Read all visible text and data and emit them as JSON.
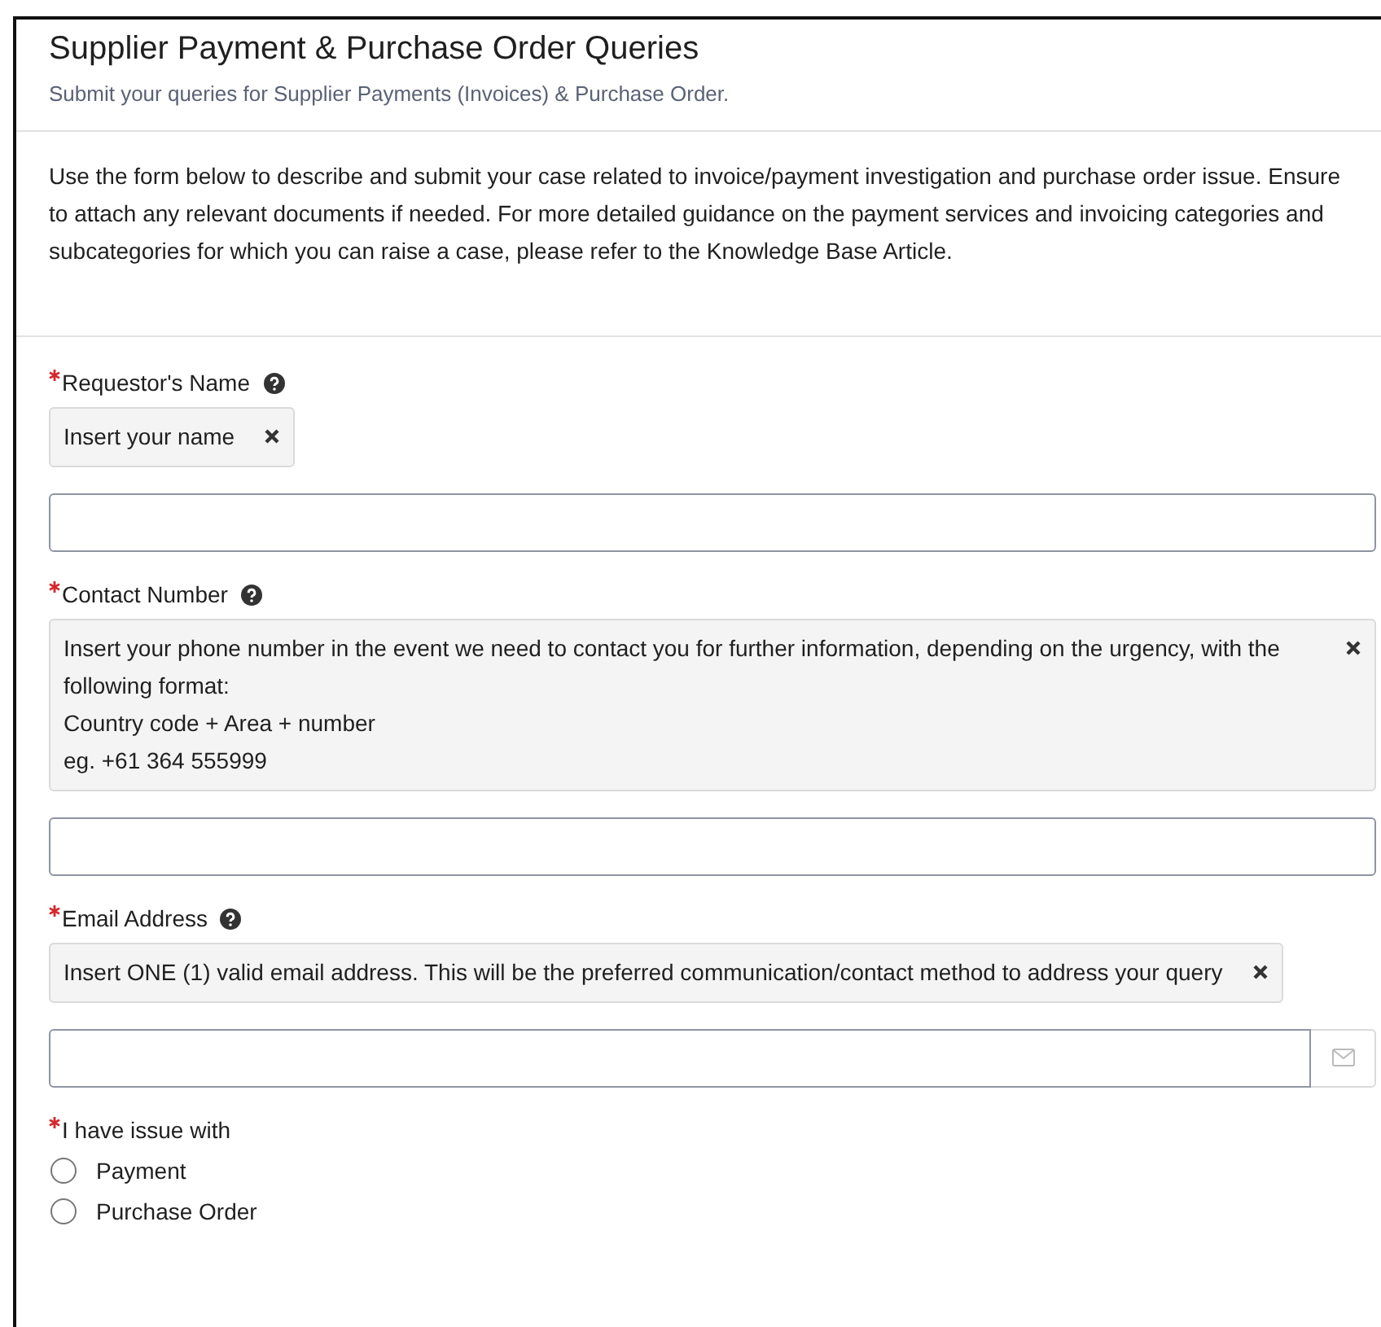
{
  "header": {
    "title": "Supplier Payment & Purchase Order Queries",
    "subtitle": "Submit your queries for Supplier Payments (Invoices) & Purchase Order."
  },
  "intro": "Use the form below to describe and submit your case related to invoice/payment investigation and purchase order issue. Ensure to attach any relevant documents if needed. For more detailed guidance on the payment  services and invoicing categories and subcategories for which you can raise a case, please refer to the Knowledge Base Article.",
  "fields": [
    {
      "kind": "text",
      "label": "Requestor's Name",
      "required": true,
      "help": true,
      "hint": [
        "Insert your name"
      ]
    },
    {
      "kind": "text",
      "label": "Contact Number",
      "required": true,
      "help": true,
      "hint": [
        "Insert your phone number in the event we need to contact you for further information, depending on the urgency, with the following format:",
        "Country code + Area + number",
        "eg. +61 364 555999"
      ]
    },
    {
      "kind": "email",
      "label": "Email Address",
      "required": true,
      "help": true,
      "hint": [
        "Insert ONE (1) valid email address. This will be the preferred communication/contact method to address your query"
      ]
    },
    {
      "kind": "radio",
      "label": "I have issue with",
      "required": true,
      "help": false,
      "options": [
        {
          "label": "Payment",
          "selected": false
        },
        {
          "label": "Purchase Order",
          "selected": false
        }
      ]
    }
  ]
}
